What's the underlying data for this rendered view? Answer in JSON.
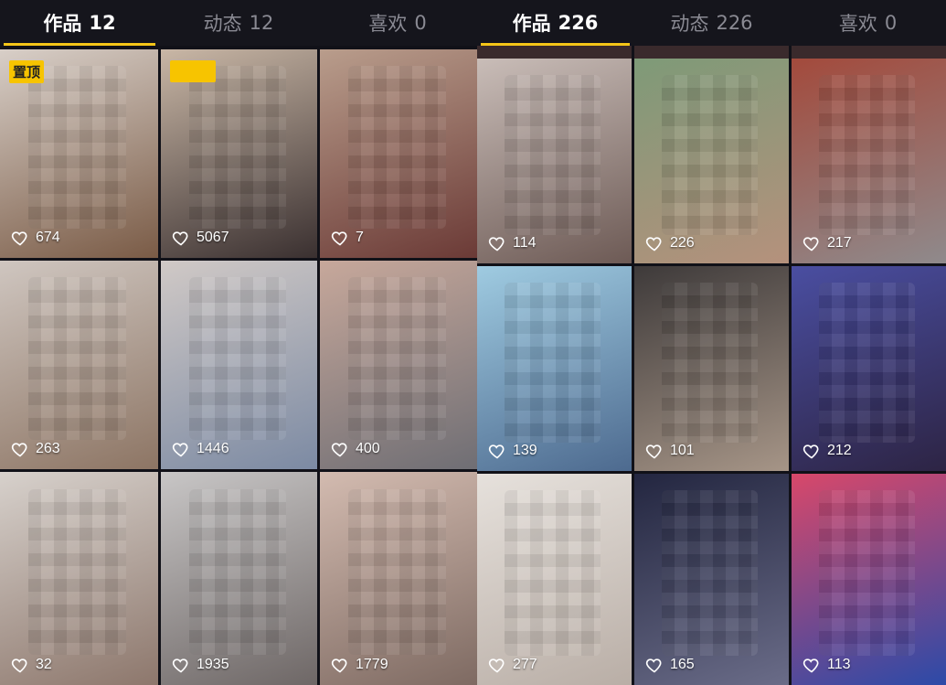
{
  "left_panel": {
    "tabs": [
      {
        "label": "作品",
        "count": "12",
        "active": true
      },
      {
        "label": "动态",
        "count": "12",
        "active": false
      },
      {
        "label": "喜欢",
        "count": "0",
        "active": false
      }
    ],
    "pinned_label": "置顶",
    "videos": [
      {
        "likes": "674",
        "pinned": true,
        "colors": [
          "#d8cfc8",
          "#7a5b46"
        ]
      },
      {
        "likes": "5067",
        "pinned": true,
        "colors": [
          "#c9b7a6",
          "#3a3030"
        ]
      },
      {
        "likes": "7",
        "colors": [
          "#b99d8c",
          "#6b3a36"
        ]
      },
      {
        "likes": "263",
        "colors": [
          "#cfc6c0",
          "#8d7564"
        ]
      },
      {
        "likes": "1446",
        "colors": [
          "#d0c9c6",
          "#7c8aa3"
        ]
      },
      {
        "likes": "400",
        "colors": [
          "#c7a89b",
          "#6f6e74"
        ]
      },
      {
        "likes": "32",
        "colors": [
          "#d7d1cc",
          "#8d776c"
        ]
      },
      {
        "likes": "1935",
        "colors": [
          "#c8c6c6",
          "#6e6766"
        ]
      },
      {
        "likes": "1779",
        "colors": [
          "#d3bbb0",
          "#7e6a62"
        ]
      }
    ]
  },
  "right_panel": {
    "tabs": [
      {
        "label": "作品",
        "count": "226",
        "active": true
      },
      {
        "label": "动态",
        "count": "226",
        "active": false
      },
      {
        "label": "喜欢",
        "count": "0",
        "active": false
      }
    ],
    "videos": [
      {
        "likes": "114",
        "colors": [
          "#c9bdb8",
          "#6d5a55"
        ]
      },
      {
        "likes": "226",
        "colors": [
          "#7e9a78",
          "#b5917c"
        ]
      },
      {
        "likes": "217",
        "colors": [
          "#a34a3c",
          "#8f8a8c"
        ]
      },
      {
        "likes": "139",
        "colors": [
          "#9fcbe1",
          "#4d6a8f"
        ]
      },
      {
        "likes": "101",
        "colors": [
          "#3e3a3a",
          "#a69587"
        ]
      },
      {
        "likes": "212",
        "colors": [
          "#4a4ea1",
          "#2d2444"
        ]
      },
      {
        "likes": "277",
        "colors": [
          "#e6e1dc",
          "#b9aea6"
        ]
      },
      {
        "likes": "165",
        "colors": [
          "#232640",
          "#6a6c88"
        ]
      },
      {
        "likes": "113",
        "colors": [
          "#d8486a",
          "#2c4aa8"
        ]
      }
    ]
  },
  "icons": {
    "like": "heart-outline-icon"
  },
  "accent_color": "#f5c518"
}
